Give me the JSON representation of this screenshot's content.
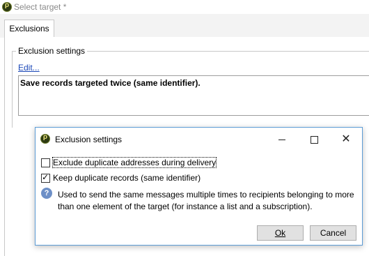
{
  "window": {
    "title": "Select target *"
  },
  "tabs": [
    {
      "label": "Exclusions"
    }
  ],
  "exclusions_tab": {
    "group_title": "Exclusion settings",
    "edit_link": "Edit...",
    "summary": "Save records targeted twice (same identifier)."
  },
  "dialog": {
    "title": "Exclusion settings",
    "options": [
      {
        "label": "Exclude duplicate addresses during delivery",
        "checked": false
      },
      {
        "label": "Keep duplicate records (same identifier)",
        "checked": true
      }
    ],
    "info_text": "Used to send the same messages multiple times to recipients belonging to more than one element of the target (for instance a list and a subscription).",
    "ok_label": "Ok",
    "cancel_label": "Cancel"
  },
  "icons": {
    "app": "app-logo-icon",
    "info": "question-mark-icon",
    "minimize": "minimize-icon",
    "maximize": "maximize-icon",
    "close": "close-icon"
  },
  "colors": {
    "link": "#1a47b7",
    "dialog_border": "#5b9bd5",
    "info_icon": "#6d8fc7"
  }
}
